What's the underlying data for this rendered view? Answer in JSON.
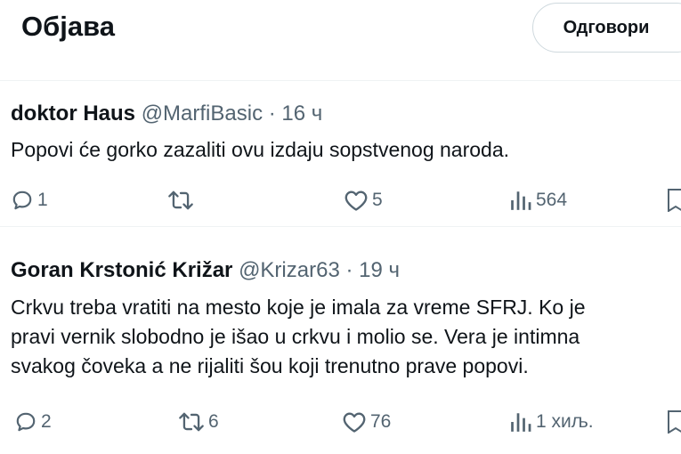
{
  "header": {
    "title": "Објава",
    "reply_label": "Одговори"
  },
  "posts": [
    {
      "name": "doktor Haus",
      "handle": "@MarfiBasic",
      "separator": "·",
      "time": "16 ч",
      "text": "Popovi će gorko zazaliti ovu izdaju sopstvenog naroda.",
      "replies": "1",
      "reposts": "",
      "likes": "5",
      "views": "564"
    },
    {
      "name": "Goran Krstonić Križar",
      "handle": "@Krizar63",
      "separator": "·",
      "time": "19 ч",
      "text": "Crkvu treba vratiti na mesto koje je imala za vreme SFRJ. Ko je\npravi vernik slobodno je išao u crkvu i molio se. Vera je intimna\nsvakog čoveka a ne rijaliti šou koji trenutno prave popovi.",
      "replies": "2",
      "reposts": "6",
      "likes": "76",
      "views": "1 хиљ."
    }
  ],
  "icons": {
    "reply": "reply-icon",
    "repost": "repost-icon",
    "like": "heart-icon",
    "views": "views-icon",
    "bookmark": "bookmark-icon"
  },
  "colors": {
    "text": "#0f1419",
    "secondary": "#536471",
    "border": "#cfd9de"
  }
}
